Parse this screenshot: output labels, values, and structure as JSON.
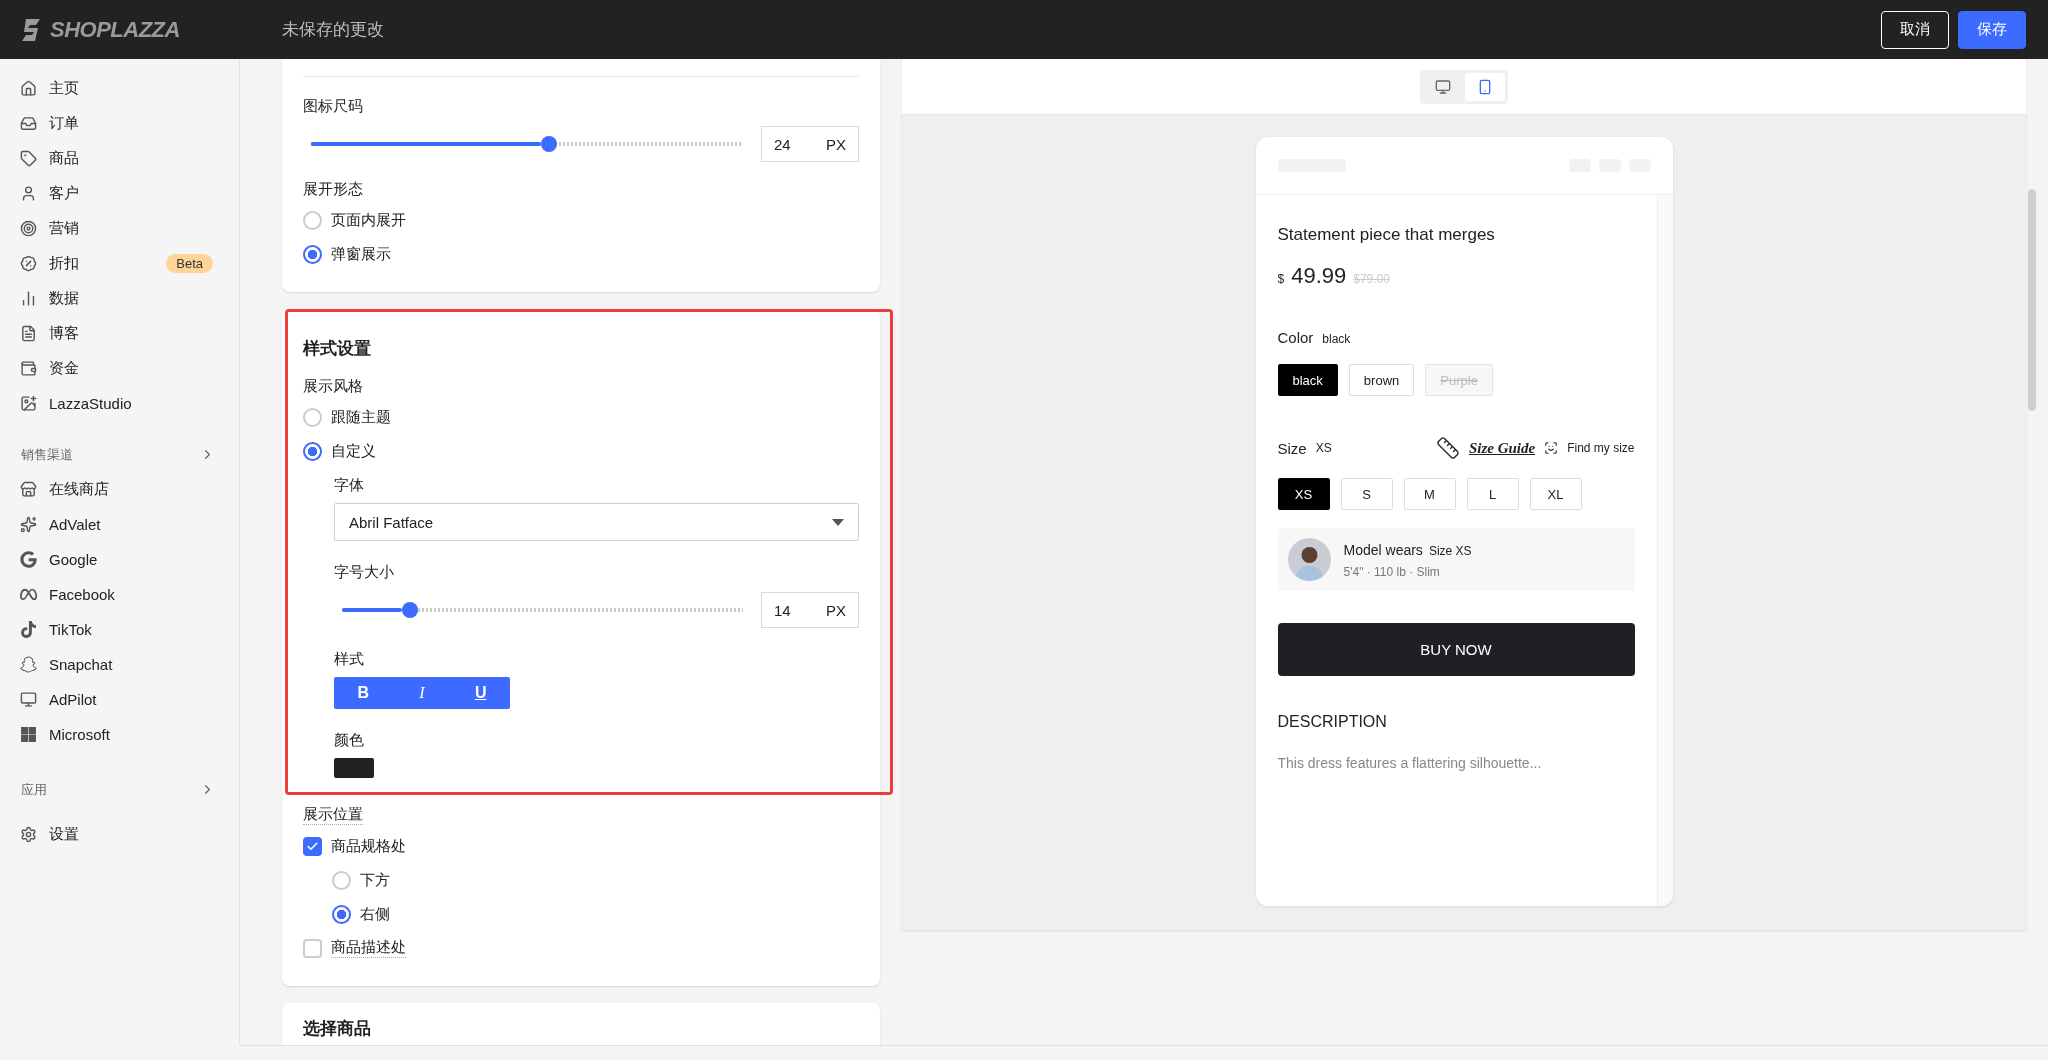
{
  "topbar": {
    "logo": "SHOPLAZZA",
    "title": "未保存的更改",
    "buttons": [
      {
        "label": "取消",
        "kind": "secondary"
      },
      {
        "label": "保存",
        "kind": "primary"
      }
    ]
  },
  "sidebar": {
    "main": [
      {
        "label": "主页"
      },
      {
        "label": "订单"
      },
      {
        "label": "商品"
      },
      {
        "label": "客户"
      },
      {
        "label": "营销"
      },
      {
        "label": "折扣",
        "badge": "Beta"
      },
      {
        "label": "数据"
      },
      {
        "label": "博客"
      },
      {
        "label": "资金"
      },
      {
        "label": "LazzaStudio"
      }
    ],
    "channels": {
      "title": "销售渠道",
      "items": [
        {
          "label": "在线商店"
        },
        {
          "label": "AdValet"
        },
        {
          "label": "Google"
        },
        {
          "label": "Facebook"
        },
        {
          "label": "TikTok"
        },
        {
          "label": "Snapchat"
        },
        {
          "label": "AdPilot"
        },
        {
          "label": "Microsoft"
        }
      ]
    },
    "apps": {
      "title": "应用"
    },
    "settings": {
      "label": "设置"
    }
  },
  "icon_size": {
    "label": "图标尺码",
    "level": 0.55,
    "value": "24",
    "unit": "PX"
  },
  "expand_mode": {
    "label": "展开形态",
    "options": [
      {
        "label": "页面内展开",
        "selected": false
      },
      {
        "label": "弹窗展示",
        "selected": true
      }
    ]
  },
  "style_settings": {
    "title": "样式设置",
    "style_label": "展示风格",
    "options": [
      {
        "label": "跟随主题",
        "selected": false
      },
      {
        "label": "自定义",
        "selected": true
      }
    ],
    "font": {
      "label": "字体",
      "value": "Abril Fatface"
    },
    "font_size": {
      "label": "字号大小",
      "level": 0.17,
      "value": "14",
      "unit": "PX"
    },
    "text_style": {
      "label": "样式",
      "buttons": [
        {
          "label": "B",
          "kind": "bold",
          "selected": true
        },
        {
          "label": "I",
          "kind": "italic",
          "selected": true
        },
        {
          "label": "U",
          "kind": "underline",
          "selected": true
        }
      ]
    },
    "color": {
      "label": "颜色",
      "color": "#222222"
    }
  },
  "position": {
    "label": "展示位置",
    "options": [
      {
        "label": "商品规格处",
        "checked": true,
        "children": [
          {
            "label": "下方",
            "selected": false
          },
          {
            "label": "右侧",
            "selected": true
          }
        ]
      },
      {
        "label": "商品描述处",
        "checked": false
      }
    ]
  },
  "select_products": {
    "title": "选择商品"
  },
  "preview": {
    "devices": [
      {
        "kind": "desktop",
        "selected": false
      },
      {
        "kind": "mobile",
        "selected": true
      }
    ],
    "product": {
      "title": "Statement piece that merges",
      "currency": "$",
      "price": "49.99",
      "compare_price": "$79.00",
      "color_label": "Color",
      "color_value": "black",
      "colors": [
        {
          "label": "black",
          "selected": true,
          "disabled": false
        },
        {
          "label": "brown",
          "selected": false,
          "disabled": false
        },
        {
          "label": "Purple",
          "selected": false,
          "disabled": true
        }
      ],
      "size_label": "Size",
      "size_value": "XS",
      "size_guide": "Size Guide",
      "find_size": "Find my size",
      "sizes": [
        {
          "label": "XS",
          "selected": true
        },
        {
          "label": "S",
          "selected": false
        },
        {
          "label": "M",
          "selected": false
        },
        {
          "label": "L",
          "selected": false
        },
        {
          "label": "XL",
          "selected": false
        }
      ],
      "model": {
        "title": "Model wears",
        "size": "Size XS",
        "stats": "5'4\" · 110 lb · Slim"
      },
      "buy": "BUY NOW",
      "description_title": "DESCRIPTION",
      "description": "This dress features a flattering silhouette..."
    }
  }
}
